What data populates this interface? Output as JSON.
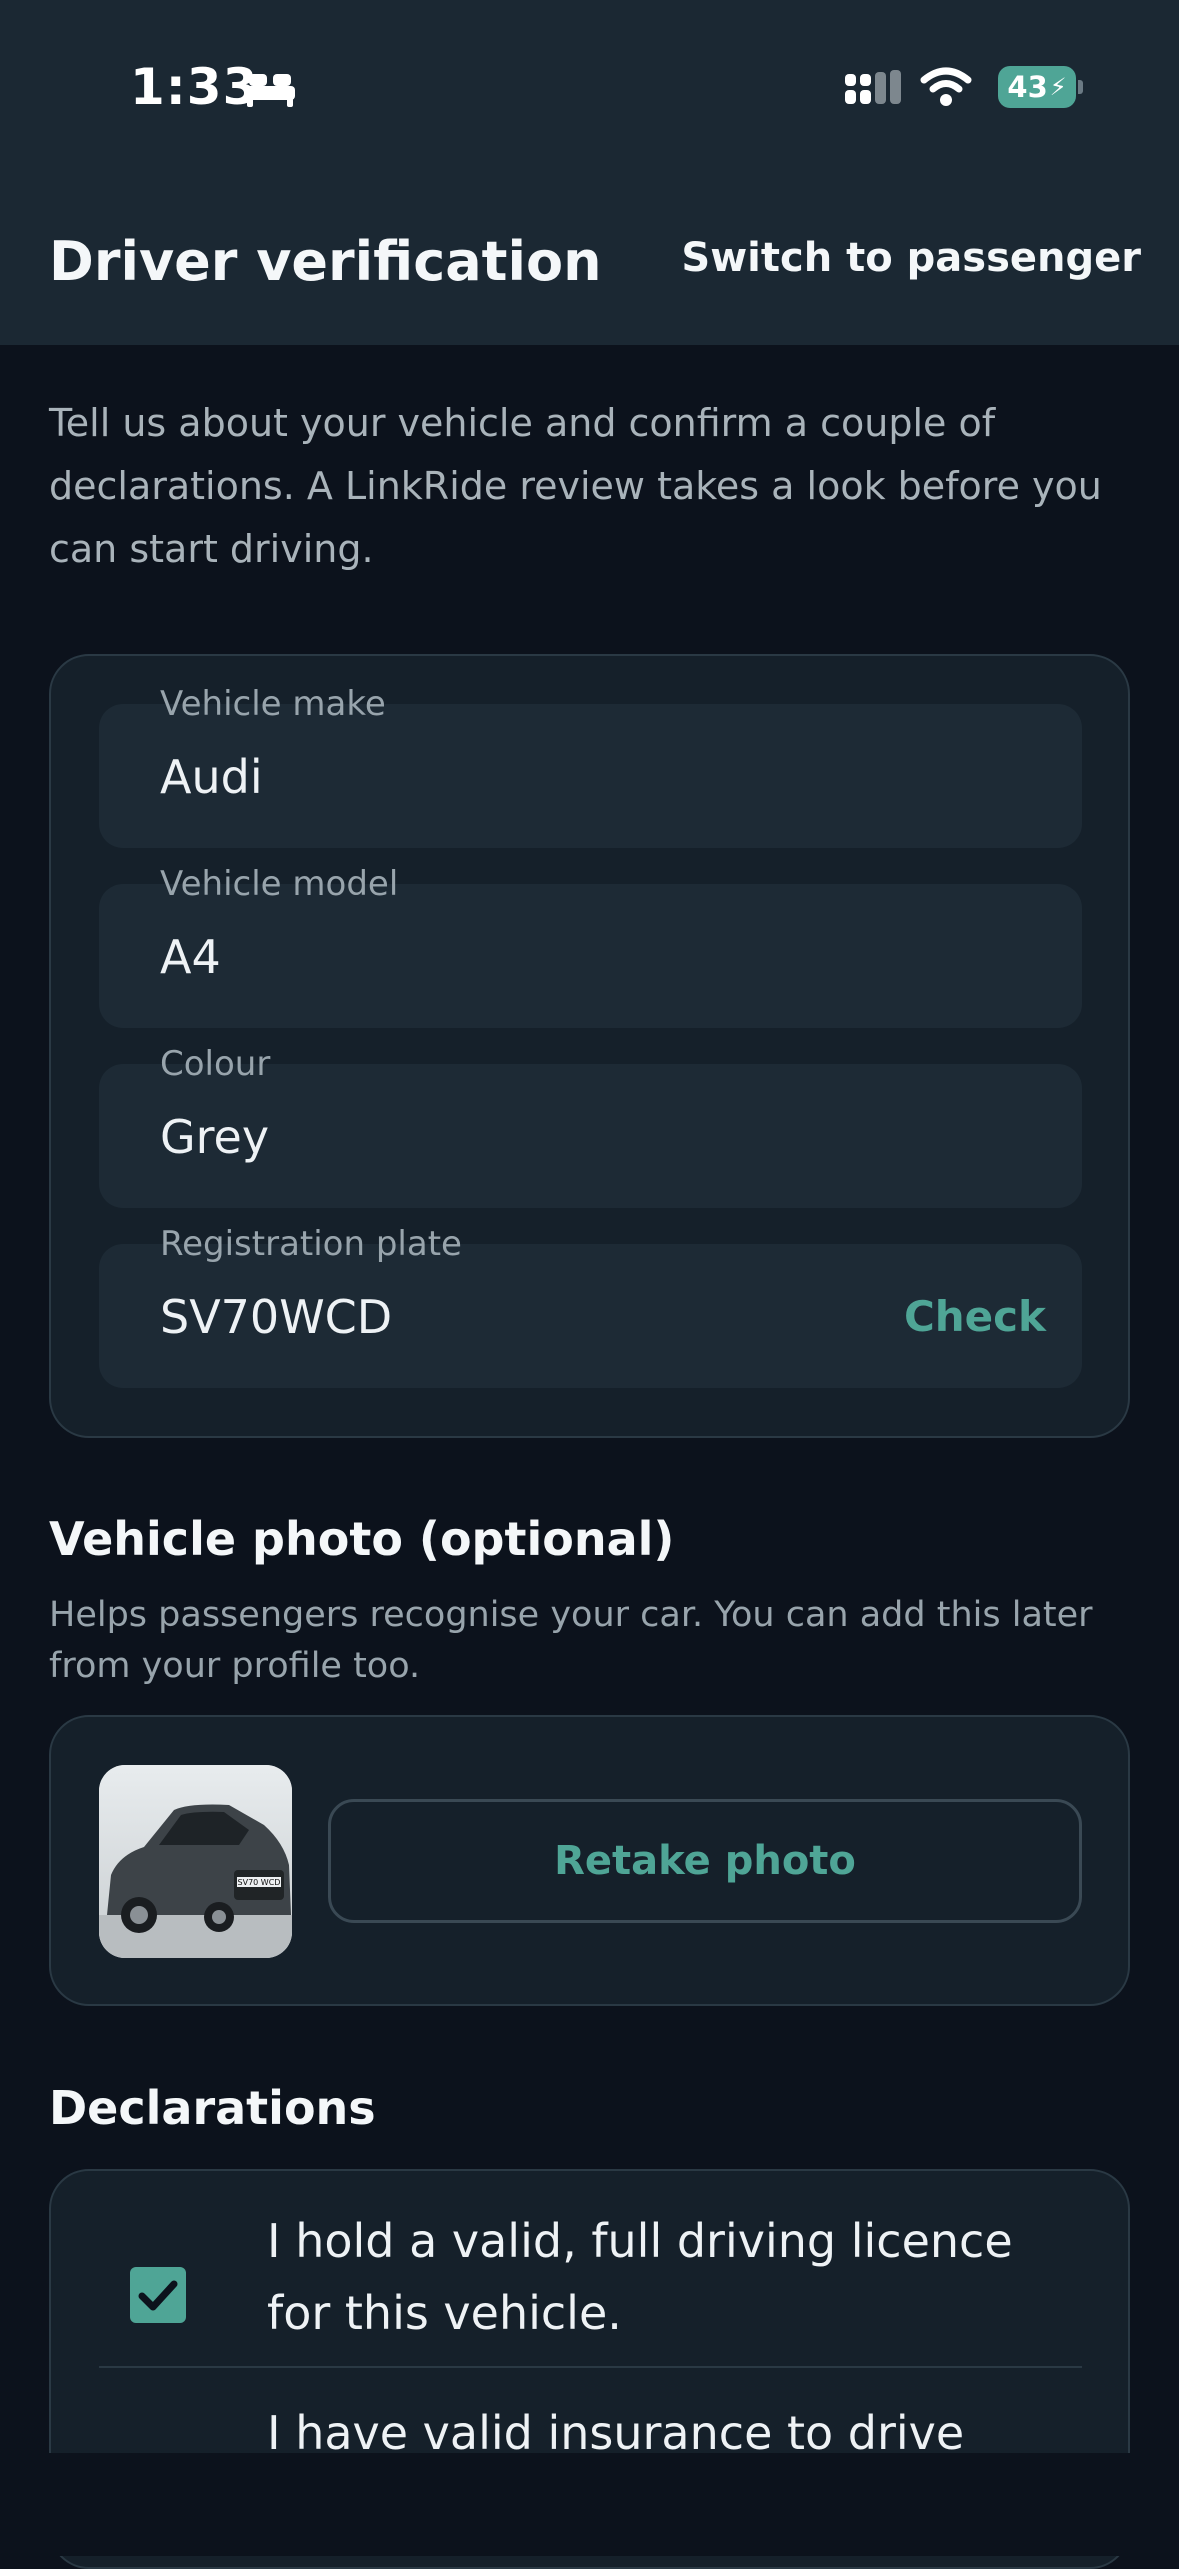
{
  "status_bar": {
    "time": "1:33",
    "battery": "43"
  },
  "header": {
    "title": "Driver verification",
    "switch_label": "Switch to passenger"
  },
  "intro": "Tell us about your vehicle and confirm a couple of declarations. A LinkRide review takes a look before you can start driving.",
  "vehicle_form": {
    "make": {
      "label": "Vehicle make",
      "value": "Audi"
    },
    "model": {
      "label": "Vehicle model",
      "value": "A4"
    },
    "colour": {
      "label": "Colour",
      "value": "Grey"
    },
    "plate": {
      "label": "Registration plate",
      "value": "SV70WCD",
      "action": "Check"
    }
  },
  "photo_section": {
    "title": "Vehicle photo (optional)",
    "subtitle": "Helps passengers recognise your car. You can add this later from your profile too.",
    "retake_label": "Retake photo",
    "plate_on_photo": "SV70 WCD"
  },
  "declarations": {
    "title": "Declarations",
    "items": [
      {
        "text": "I hold a valid, full driving licence for this vehicle.",
        "checked": true
      },
      {
        "text": "I have valid insurance to drive",
        "checked": true
      }
    ]
  },
  "colors": {
    "accent": "#4fa596",
    "background": "#0c121c",
    "header": "#1b2833",
    "card": "#15202a"
  }
}
